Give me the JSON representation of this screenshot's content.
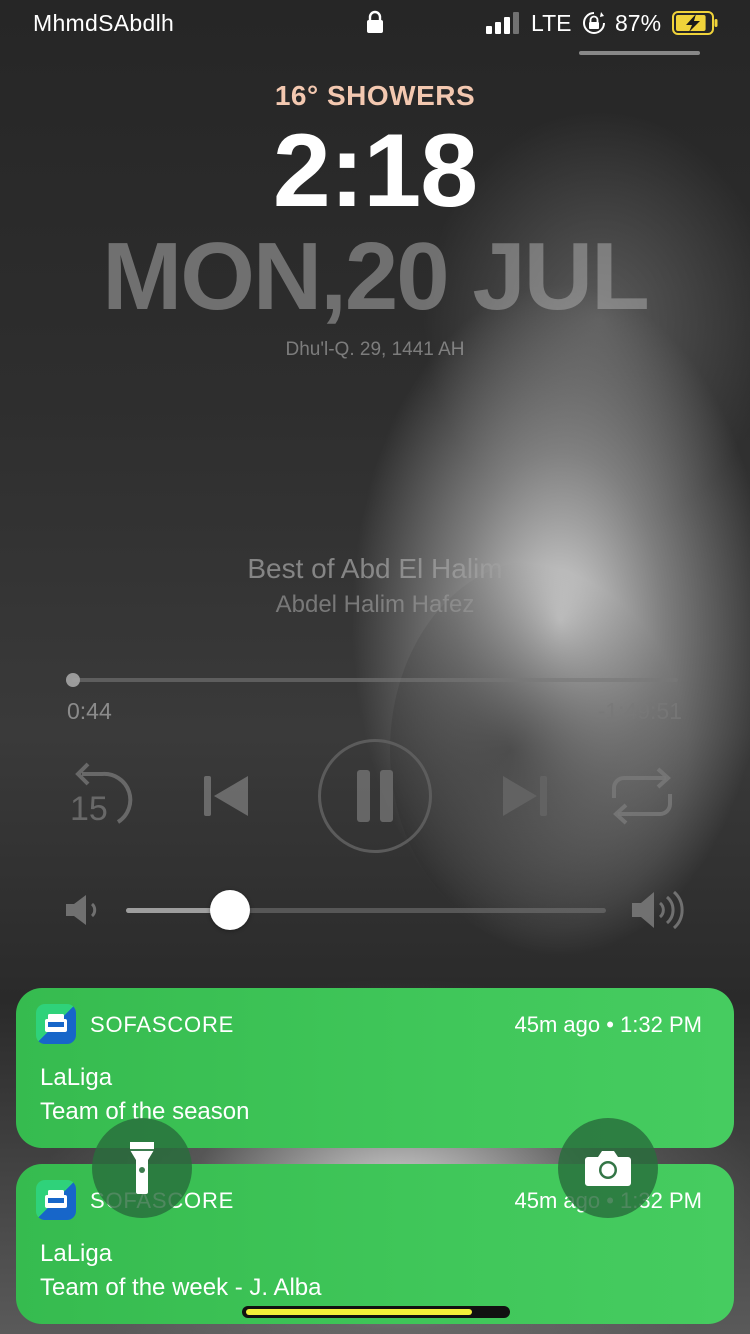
{
  "status_bar": {
    "carrier": "MhmdSAbdlh",
    "network": "LTE",
    "battery_percent": "87%",
    "battery_level": 0.87,
    "battery_charging": true,
    "signal_bars": 3,
    "icons": {
      "lock": "lock-icon",
      "signal": "signal-icon",
      "rotation_lock": "rotation-lock-icon",
      "battery": "battery-charging-icon"
    },
    "colors": {
      "battery_fill": "#f0d33a"
    }
  },
  "lockscreen": {
    "weather": "16° SHOWERS",
    "time": "2:18",
    "date": "MON,20 JUL",
    "hijri_date": "Dhu'l-Q. 29, 1441 AH",
    "colors": {
      "weather": "#f3c8b0"
    }
  },
  "media": {
    "title": "Best of Abd El Halim",
    "artist": "Abdel Halim Hafez",
    "elapsed": "0:44",
    "remaining": "-1:49:51",
    "progress": 0.0,
    "volume": 0.22,
    "skip_back_seconds": "15",
    "icons": {
      "skip_back": "skip-back-15-icon",
      "previous": "previous-track-icon",
      "pause": "pause-icon",
      "next": "next-track-icon",
      "repeat": "repeat-icon",
      "volume_low": "volume-low-icon",
      "volume_high": "volume-high-icon"
    }
  },
  "notifications": [
    {
      "app": "SOFASCORE",
      "time": "45m ago • 1:32 PM",
      "title": "LaLiga",
      "body": "Team of the season",
      "icon": "sofascore-app-icon"
    },
    {
      "app": "SOFASCORE",
      "time": "45m ago • 1:32 PM",
      "title": "LaLiga",
      "body": "Team of the week - J. Alba",
      "icon": "sofascore-app-icon"
    }
  ],
  "quick_actions": {
    "flashlight": "flashlight-icon",
    "camera": "camera-icon"
  },
  "colors": {
    "notification_bg": "#40c75a",
    "home_indicator": "#f3f03a"
  }
}
